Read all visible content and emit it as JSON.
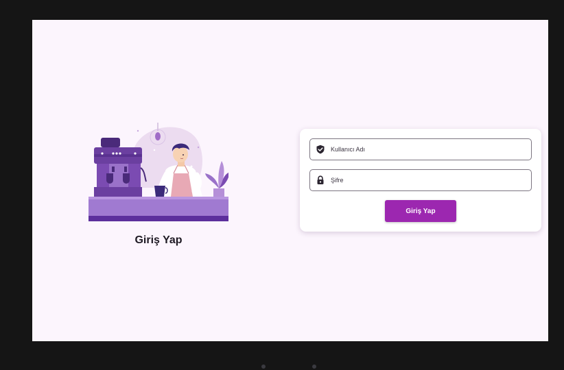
{
  "page": {
    "title": "Giriş Yap"
  },
  "login_form": {
    "username_placeholder": "Kullanıcı Adı",
    "password_placeholder": "Şifre",
    "submit_label": "Giriş Yap"
  },
  "icons": {
    "username": "shield-check-icon",
    "password": "lock-icon",
    "illustration": "barista-coffee-illustration"
  },
  "colors": {
    "accent": "#9c27b0",
    "background": "#fcf5fd",
    "card": "#ffffff",
    "field_border": "#7b7480"
  }
}
